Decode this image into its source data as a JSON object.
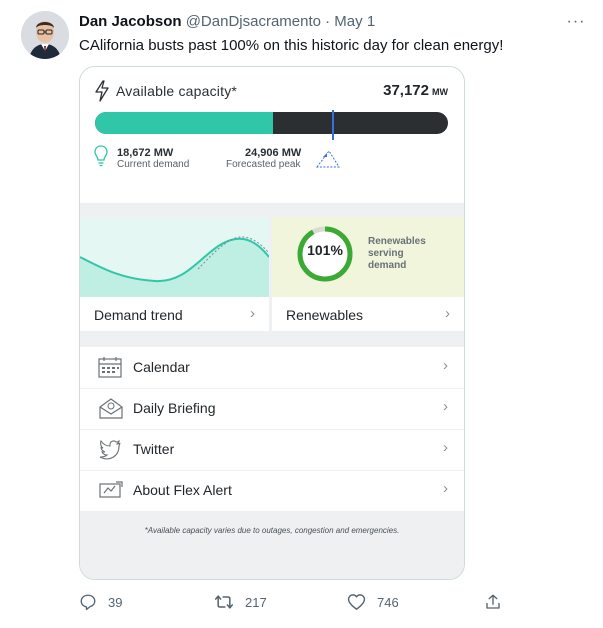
{
  "tweet": {
    "author_name": "Dan Jacobson",
    "handle_and_date": "@DanDjsacramento · May 1",
    "more_label": "···",
    "text": "CAlifornia busts past 100% on this historic day for clean energy!"
  },
  "card": {
    "capacity": {
      "title": "Available capacity*",
      "value": "37,172",
      "unit": "MW",
      "current_demand_fraction": 0.503,
      "forecast_peak_fraction": 0.67
    },
    "current_demand": {
      "value": "18,672 MW",
      "label": "Current demand"
    },
    "forecasted_peak": {
      "value": "24,906 MW",
      "label": "Forecasted peak"
    },
    "tiles": {
      "demand_trend": {
        "label": "Demand trend",
        "chevron": "›"
      },
      "renewables": {
        "label": "Renewables",
        "chevron": "›",
        "percent": "101%",
        "percent_fraction": 1.01,
        "caption_line1": "Renewables",
        "caption_line2": "serving",
        "caption_line3": "demand"
      }
    },
    "menu": [
      {
        "label": "Calendar",
        "icon": "calendar-icon",
        "chevron": "›"
      },
      {
        "label": "Daily Briefing",
        "icon": "envelope-icon",
        "chevron": "›"
      },
      {
        "label": "Twitter",
        "icon": "twitter-bird-icon",
        "chevron": "›"
      },
      {
        "label": "About Flex Alert",
        "icon": "flex-alert-icon",
        "chevron": "›"
      }
    ],
    "footnote": "*Available capacity varies due to outages, congestion and emergencies."
  },
  "actions": {
    "replies": "39",
    "retweets": "217",
    "likes": "746"
  },
  "colors": {
    "teal": "#2fc7a8",
    "bar_dark": "#2c2f31",
    "peak_marker": "#3b6fd8",
    "renewables_green": "#3aaa35",
    "renewables_bg": "#f0f5dc"
  }
}
